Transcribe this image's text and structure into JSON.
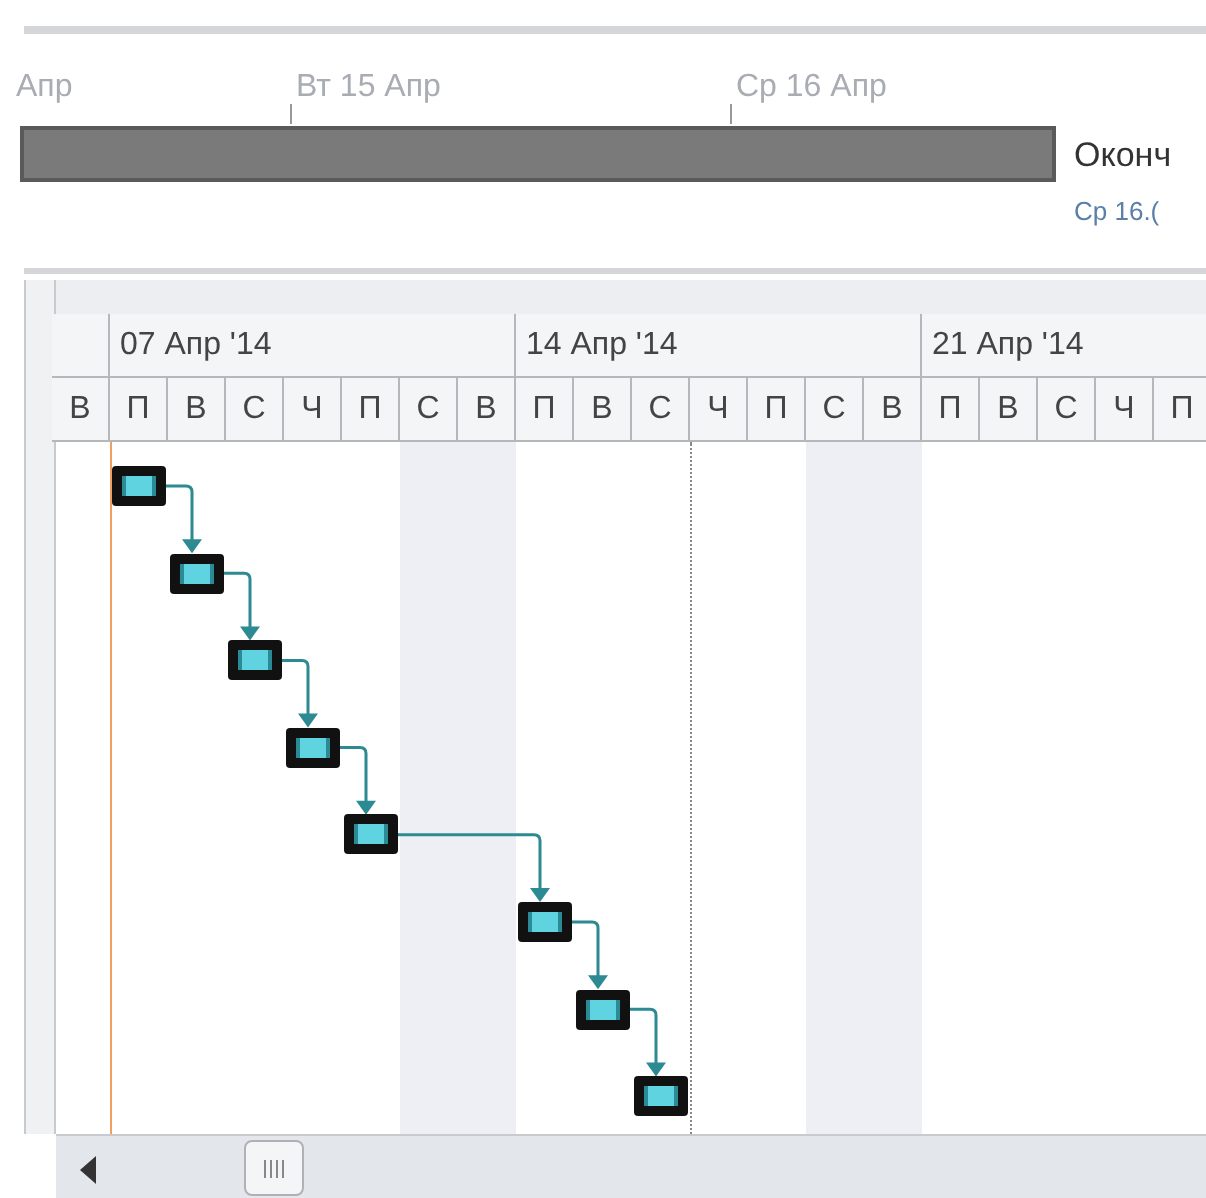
{
  "timeline": {
    "labels": [
      "Апр",
      "Вт 15 Апр",
      "Ср 16 Апр"
    ],
    "bar": {
      "label": "Оконч",
      "date": "Ср 16.("
    }
  },
  "gantt": {
    "weeks": [
      "07 Апр '14",
      "14 Апр '14",
      "21 Апр '14"
    ],
    "days": [
      {
        "label": "В",
        "weekend": false,
        "task": false,
        "current": false
      },
      {
        "label": "П",
        "weekend": false,
        "task": true,
        "current": false
      },
      {
        "label": "В",
        "weekend": false,
        "task": true,
        "current": false
      },
      {
        "label": "С",
        "weekend": false,
        "task": true,
        "current": false
      },
      {
        "label": "Ч",
        "weekend": false,
        "task": true,
        "current": false
      },
      {
        "label": "П",
        "weekend": false,
        "task": true,
        "current": false
      },
      {
        "label": "С",
        "weekend": true,
        "task": false,
        "current": false
      },
      {
        "label": "В",
        "weekend": true,
        "task": false,
        "current": false
      },
      {
        "label": "П",
        "weekend": false,
        "task": true,
        "current": false
      },
      {
        "label": "В",
        "weekend": false,
        "task": true,
        "current": false
      },
      {
        "label": "С",
        "weekend": false,
        "task": true,
        "current": true
      },
      {
        "label": "Ч",
        "weekend": false,
        "task": false,
        "current": false
      },
      {
        "label": "П",
        "weekend": false,
        "task": false,
        "current": false
      },
      {
        "label": "С",
        "weekend": true,
        "task": false,
        "current": false
      },
      {
        "label": "В",
        "weekend": true,
        "task": false,
        "current": false
      },
      {
        "label": "П",
        "weekend": false,
        "task": false,
        "current": false
      },
      {
        "label": "В",
        "weekend": false,
        "task": false,
        "current": false
      },
      {
        "label": "С",
        "weekend": false,
        "task": false,
        "current": false
      },
      {
        "label": "Ч",
        "weekend": false,
        "task": false,
        "current": false
      },
      {
        "label": "П",
        "weekend": false,
        "task": false,
        "current": false
      }
    ]
  }
}
